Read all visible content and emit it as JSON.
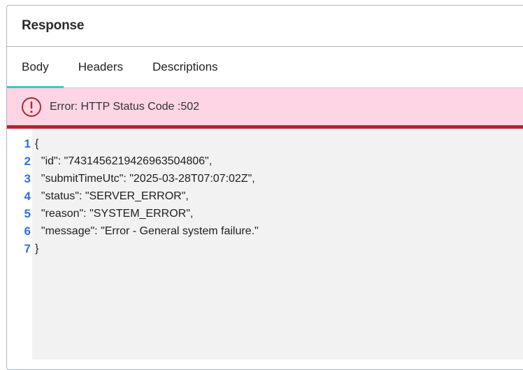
{
  "panel": {
    "title": "Response"
  },
  "tabs": [
    {
      "label": "Body",
      "active": true
    },
    {
      "label": "Headers",
      "active": false
    },
    {
      "label": "Descriptions",
      "active": false
    }
  ],
  "alert": {
    "icon": "error-circle-icon",
    "text": "Error: HTTP Status Code :502",
    "background_color": "#fdd5e5",
    "border_color": "#b3262d"
  },
  "code": {
    "line_numbers": [
      "1",
      "2",
      "3",
      "4",
      "5",
      "6",
      "7"
    ],
    "lines": [
      "{",
      "  \"id\": \"743145621942696350480​6\",",
      "  \"submitTimeUtc\": \"2025-03-28T07:07:02Z\",",
      "  \"status\": \"SERVER_ERROR\",",
      "  \"reason\": \"SYSTEM_ERROR\",",
      "  \"message\": \"Error - General system failure.\"",
      "}"
    ]
  },
  "colors": {
    "tab_indicator": "#3cc8c8",
    "line_number": "#2f6fe0"
  }
}
